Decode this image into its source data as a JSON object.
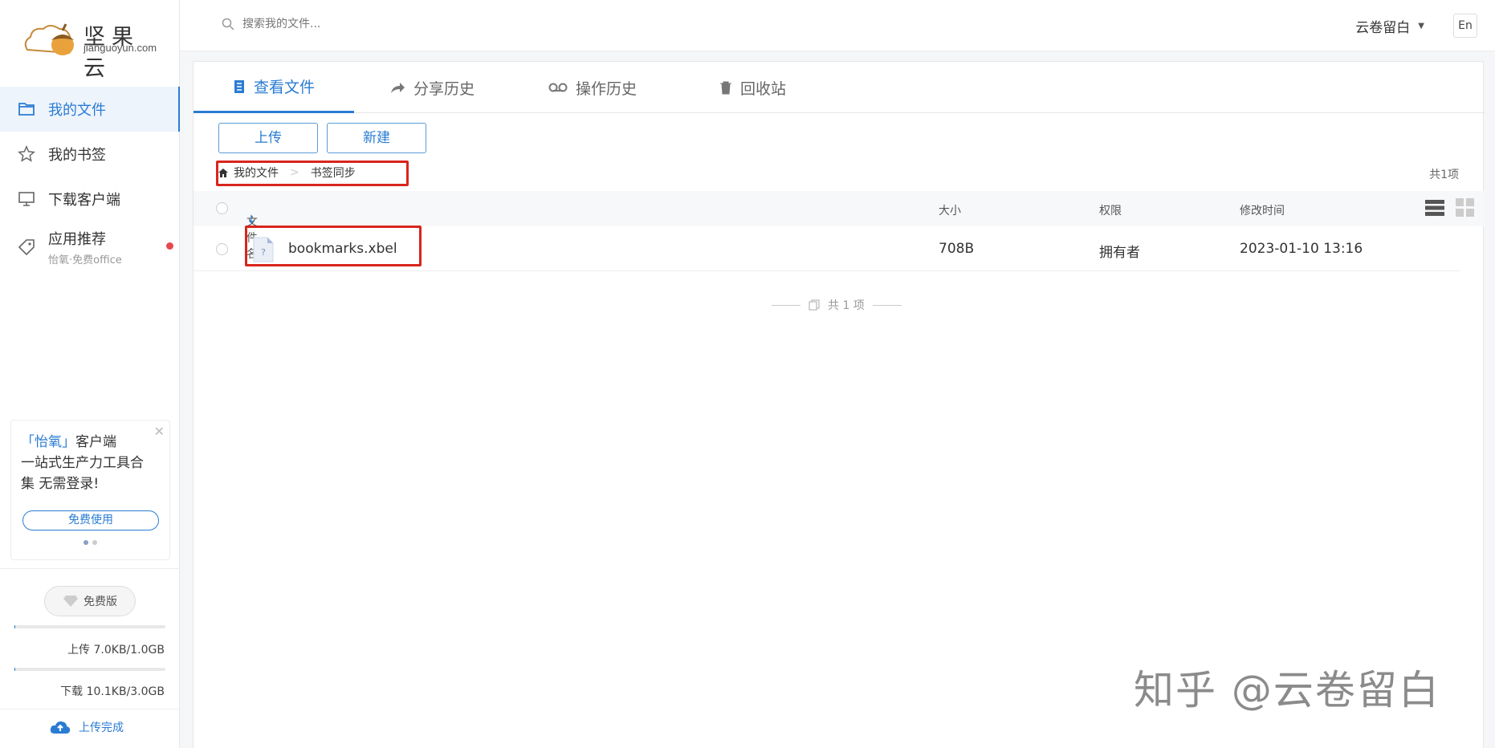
{
  "brand": {
    "cn": "坚果云",
    "en": "jianguoyun.com"
  },
  "search": {
    "placeholder": "搜索我的文件..."
  },
  "user": {
    "name": "云卷留白"
  },
  "lang": "En",
  "sidebar": {
    "items": [
      {
        "label": "我的文件",
        "icon": "folder-icon",
        "active": true
      },
      {
        "label": "我的书签",
        "icon": "star-icon"
      },
      {
        "label": "下载客户端",
        "icon": "monitor-icon"
      },
      {
        "label": "应用推荐",
        "sub": "怡氧·免费office",
        "icon": "tag-icon"
      }
    ],
    "promo": {
      "hl": "「怡氧」",
      "line1": "客户端",
      "line2": "一站式生产力工具合",
      "line3": "集 无需登录!",
      "button": "免费使用"
    },
    "plan": "免费版",
    "upload_quota": "上传 7.0KB/1.0GB",
    "download_quota": "下载 10.1KB/3.0GB",
    "status": "上传完成"
  },
  "tabs": [
    {
      "label": "查看文件",
      "icon": "document-icon",
      "active": true
    },
    {
      "label": "分享历史",
      "icon": "share-icon"
    },
    {
      "label": "操作历史",
      "icon": "history-icon"
    },
    {
      "label": "回收站",
      "icon": "trash-icon"
    }
  ],
  "toolbar": {
    "upload": "上传",
    "new": "新建"
  },
  "breadcrumb": {
    "root": "我的文件",
    "current": "书签同步"
  },
  "total": "共1项",
  "table": {
    "columns": [
      "文件名",
      "大小",
      "权限",
      "修改时间"
    ],
    "rows": [
      {
        "name": "bookmarks.xbel",
        "size": "708B",
        "permission": "拥有者",
        "modified": "2023-01-10 13:16"
      }
    ]
  },
  "footer_count": "共 1 项",
  "watermark": "知乎 @云卷留白",
  "colors": {
    "accent": "#2a7cd3",
    "highlight": "#d9251c"
  }
}
